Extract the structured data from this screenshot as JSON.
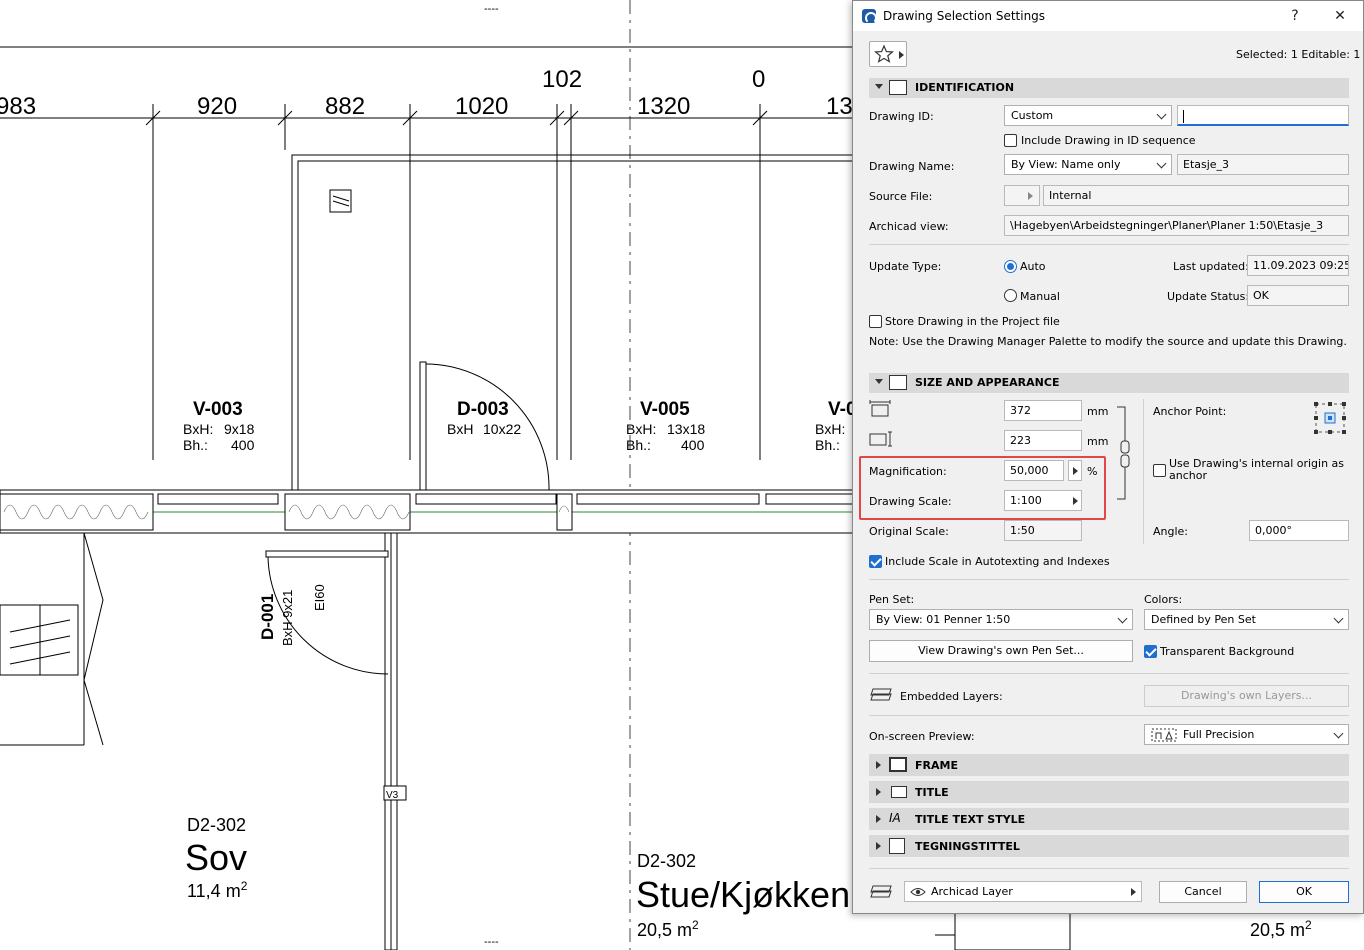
{
  "drawing": {
    "dims_top": [
      "983",
      "920",
      "882",
      "1020",
      "102",
      "1320",
      "0",
      "13"
    ],
    "windows": [
      {
        "id": "V-003",
        "bxh_label": "BxH:",
        "bxh": "9x18",
        "bh_label": "Bh.:",
        "bh": "400"
      },
      {
        "id": "V-005",
        "bxh_label": "BxH:",
        "bxh": "13x18",
        "bh_label": "Bh.:",
        "bh": "400"
      },
      {
        "id": "V-0",
        "bxh_label": "BxH:",
        "bh_label": "Bh.:"
      }
    ],
    "door_d003": {
      "id": "D-003",
      "bxh_label": "BxH",
      "bxh": "10x22"
    },
    "door_d001": {
      "id": "D-001",
      "bxh": "BxH  9x21",
      "rating": "EI60"
    },
    "wall_tag": "V3",
    "rooms": [
      {
        "code": "D2-302",
        "name": "Sov",
        "area": "11,4 m",
        "sup": "2"
      },
      {
        "code": "D2-302",
        "name": "Stue/Kjøkken",
        "area": "20,5 m",
        "sup": "2"
      },
      {
        "area": "20,5 m",
        "sup": "2"
      }
    ],
    "top_marker": "----",
    "bottom_marker": "----"
  },
  "dialog": {
    "title": "Drawing Selection Settings",
    "help": "?",
    "close": "✕",
    "selected": "Selected: 1 Editable: 1",
    "identification": {
      "title": "IDENTIFICATION",
      "drawing_id_label": "Drawing ID:",
      "drawing_id_mode": "Custom",
      "drawing_id_value": "",
      "include_in_sequence": "Include Drawing in ID sequence",
      "drawing_name_label": "Drawing Name:",
      "drawing_name_mode": "By View: Name only",
      "drawing_name_value": "Etasje_3",
      "source_file_label": "Source File:",
      "source_file_value": "Internal",
      "archicad_view_label": "Archicad view:",
      "archicad_view_value": "\\Hagebyen\\Arbeidstegninger\\Planer\\Planer 1:50\\Etasje_3",
      "update_type_label": "Update Type:",
      "update_auto": "Auto",
      "update_manual": "Manual",
      "last_updated_label": "Last updated:",
      "last_updated_value": "11.09.2023 09:25",
      "update_status_label": "Update Status:",
      "update_status_value": "OK",
      "store_drawing": "Store Drawing in the Project file",
      "note": "Note: Use the Drawing Manager Palette to modify the source and update this Drawing."
    },
    "size": {
      "title": "SIZE AND APPEARANCE",
      "width_value": "372",
      "height_value": "223",
      "unit": "mm",
      "anchor_label": "Anchor Point:",
      "magnification_label": "Magnification:",
      "magnification_value": "50,000",
      "percent": "%",
      "drawing_scale_label": "Drawing Scale:",
      "drawing_scale_value": "1:100",
      "original_scale_label": "Original Scale:",
      "original_scale_value": "1:50",
      "internal_origin": "Use Drawing's internal origin as anchor",
      "angle_label": "Angle:",
      "angle_value": "0,000°",
      "include_scale": "Include Scale in Autotexting and Indexes",
      "pen_set_label": "Pen Set:",
      "pen_set_value": "By View: 01 Penner 1:50",
      "colors_label": "Colors:",
      "colors_value": "Defined by Pen Set",
      "view_pen_set_button": "View Drawing's own Pen Set...",
      "transparent_background": "Transparent Background",
      "embedded_layers_label": "Embedded Layers:",
      "drawing_layers_button": "Drawing's own Layers...",
      "onscreen_preview_label": "On-screen Preview:",
      "onscreen_preview_value": "Full Precision"
    },
    "collapsed_sections": [
      "FRAME",
      "TITLE",
      "TITLE TEXT STYLE",
      "TEGNINGSTITTEL"
    ],
    "footer": {
      "layer_value": "Archicad Layer",
      "cancel": "Cancel",
      "ok": "OK"
    }
  }
}
